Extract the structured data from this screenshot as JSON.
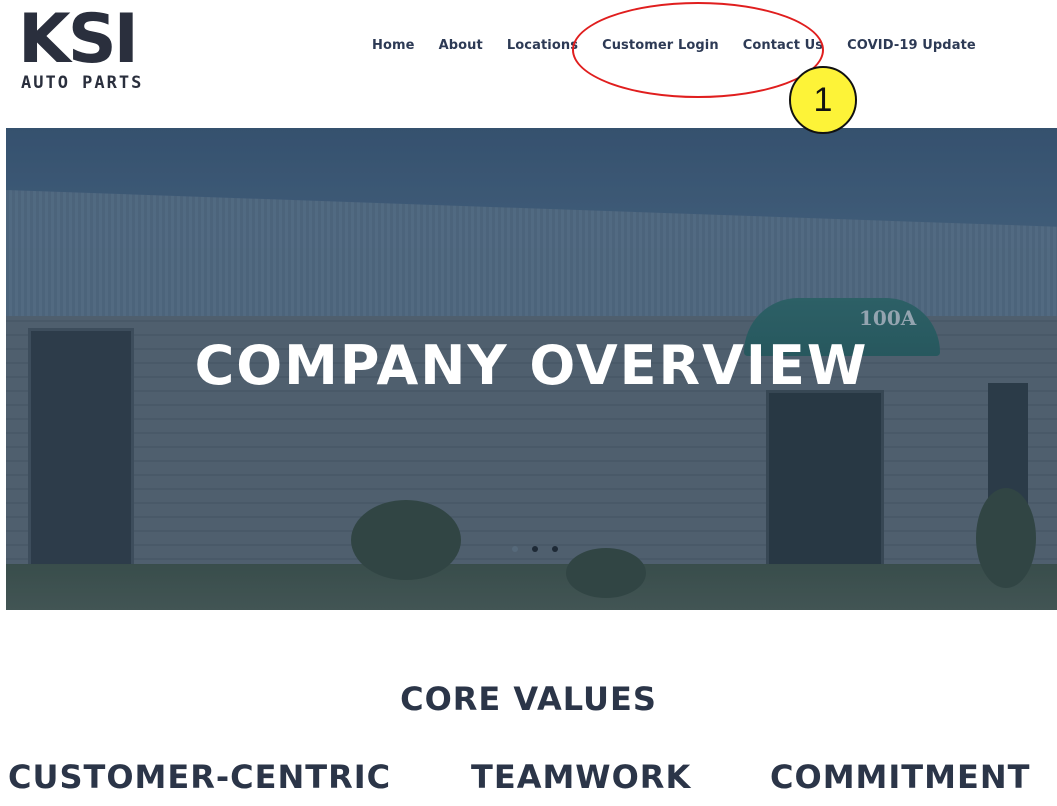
{
  "logo": {
    "mark": "KSI",
    "sub": "AUTO PARTS"
  },
  "nav": {
    "items": [
      {
        "label": "Home"
      },
      {
        "label": "About"
      },
      {
        "label": "Locations"
      },
      {
        "label": "Customer Login"
      },
      {
        "label": "Contact Us"
      },
      {
        "label": "COVID-19 Update"
      }
    ]
  },
  "annotation": {
    "badge": "1",
    "ellipse_color": "#e01e1e",
    "badge_color": "#fdf338"
  },
  "hero": {
    "title": "COMPANY OVERVIEW",
    "building_number": "100A",
    "slide_count": 3,
    "active_slide": 2
  },
  "core_values": {
    "title": "CORE VALUES",
    "items": [
      {
        "label": "CUSTOMER-CENTRIC"
      },
      {
        "label": "TEAMWORK"
      },
      {
        "label": "COMMITMENT"
      }
    ]
  },
  "colors": {
    "text_dark": "#2b3548",
    "nav_text": "#2d3a55",
    "hero_tint": "#3c5a76"
  }
}
